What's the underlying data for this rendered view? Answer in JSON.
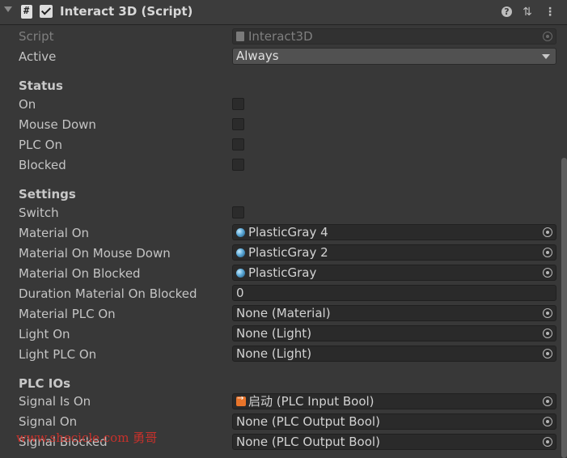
{
  "header": {
    "title": "Interact 3D (Script)",
    "enabled": true,
    "icons": [
      "foldout-arrow-icon",
      "script-file-icon",
      "help-icon",
      "presets-icon",
      "context-menu-icon"
    ]
  },
  "rows": {
    "script": {
      "label": "Script",
      "value": "Interact3D"
    },
    "active": {
      "label": "Active",
      "value": "Always"
    }
  },
  "status": {
    "header": "Status",
    "on": {
      "label": "On",
      "checked": false
    },
    "mouse_down": {
      "label": "Mouse Down",
      "checked": false
    },
    "plc_on": {
      "label": "PLC On",
      "checked": false
    },
    "blocked": {
      "label": "Blocked",
      "checked": false
    }
  },
  "settings": {
    "header": "Settings",
    "switch": {
      "label": "Switch",
      "checked": false
    },
    "material_on": {
      "label": "Material On",
      "value": "PlasticGray 4"
    },
    "material_on_mouse_down": {
      "label": "Material On Mouse Down",
      "value": "PlasticGray 2"
    },
    "material_on_blocked": {
      "label": "Material On Blocked",
      "value": "PlasticGray"
    },
    "duration_material_on_blocked": {
      "label": "Duration Material On Blocked",
      "value": "0"
    },
    "material_plc_on": {
      "label": "Material PLC On",
      "value": "None (Material)"
    },
    "light_on": {
      "label": "Light On",
      "value": "None (Light)"
    },
    "light_plc_on": {
      "label": "Light PLC On",
      "value": "None (Light)"
    }
  },
  "plc_ios": {
    "header": "PLC IOs",
    "signal_is_on": {
      "label": "Signal Is On",
      "value": "启动 (PLC Input Bool)"
    },
    "signal_on": {
      "label": "Signal On",
      "value": "None (PLC Output Bool)"
    },
    "signal_blocked": {
      "label": "Signal Blocked",
      "value": "None (PLC Output Bool)"
    }
  },
  "watermark": "www.shecicle.com 勇哥",
  "colors": {
    "background": "#383838",
    "field": "#2a2a2a",
    "dropdown": "#515151",
    "watermark": "#d8312a"
  }
}
